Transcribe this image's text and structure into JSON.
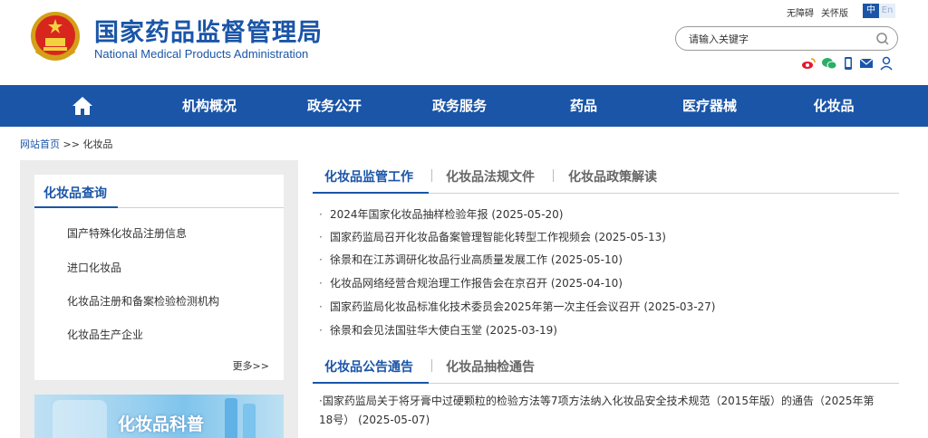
{
  "header": {
    "title": "国家药品监督管理局",
    "subtitle": "National Medical Products Administration",
    "top_links": [
      "无障碍",
      "关怀版"
    ],
    "lang": {
      "zh": "中",
      "en": "En"
    },
    "search_placeholder": "请输入关键字",
    "share_icons": [
      "weibo-icon",
      "wechat-icon",
      "mobile-icon",
      "email-icon",
      "user-icon"
    ]
  },
  "nav": {
    "items": [
      "机构概况",
      "政务公开",
      "政务服务",
      "药品",
      "医疗器械",
      "化妆品"
    ]
  },
  "breadcrumb": {
    "home": "网站首页",
    "sep": ">>",
    "current": "化妆品"
  },
  "sidebar": {
    "title": "化妆品查询",
    "items": [
      "国产特殊化妆品注册信息",
      "进口化妆品",
      "化妆品注册和备案检验检测机构",
      "化妆品生产企业"
    ],
    "more": "更多>>",
    "banner": "化妆品科普"
  },
  "tabs1": {
    "items": [
      "化妆品监管工作",
      "化妆品法规文件",
      "化妆品政策解读"
    ],
    "active": 0
  },
  "news1": [
    {
      "title": "2024年国家化妆品抽样检验年报",
      "date": "(2025-05-20)"
    },
    {
      "title": "国家药监局召开化妆品备案管理智能化转型工作视频会",
      "date": "(2025-05-13)"
    },
    {
      "title": "徐景和在江苏调研化妆品行业高质量发展工作",
      "date": "(2025-05-10)"
    },
    {
      "title": "化妆品网络经营合规治理工作报告会在京召开",
      "date": "(2025-04-10)"
    },
    {
      "title": "国家药监局化妆品标准化技术委员会2025年第一次主任会议召开",
      "date": "(2025-03-27)"
    },
    {
      "title": "徐景和会见法国驻华大使白玉堂",
      "date": "(2025-03-19)"
    }
  ],
  "tabs2": {
    "items": [
      "化妆品公告通告",
      "化妆品抽检通告"
    ],
    "active": 0
  },
  "news2": [
    {
      "title": "国家药监局关于将牙膏中过硬颗粒的检验方法等7项方法纳入化妆品安全技术规范（2015年版）的通告（2025年第18号）",
      "date": "(2025-05-07)"
    }
  ],
  "colors": {
    "brand": "#1a55a8",
    "nav_bg": "#1a55a8"
  }
}
